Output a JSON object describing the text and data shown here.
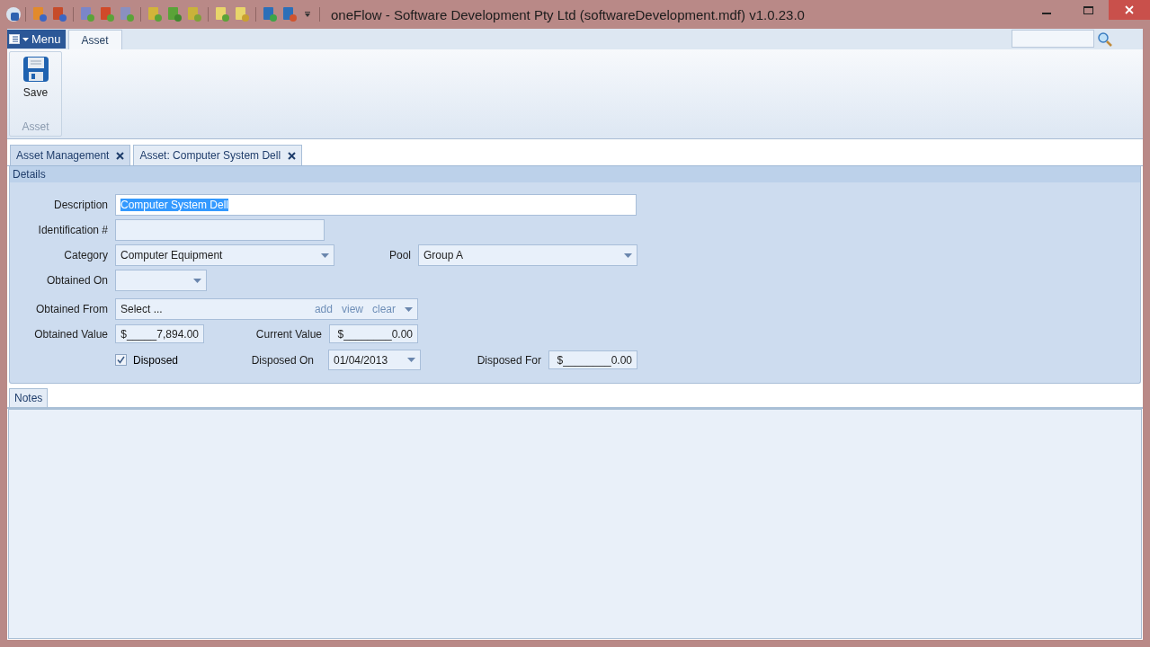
{
  "window": {
    "title": "oneFlow - Software Development Pty Ltd (softwareDevelopment.mdf) v1.0.23.0"
  },
  "ribbon": {
    "menu_button": "Menu",
    "tabs": [
      {
        "label": "Asset",
        "selected": true
      }
    ],
    "groups": [
      {
        "label": "Asset",
        "buttons": [
          {
            "label": "Save"
          }
        ]
      }
    ]
  },
  "document_tabs": [
    {
      "label": "Asset Management",
      "selected": false
    },
    {
      "label": "Asset: Computer System Dell",
      "selected": true
    }
  ],
  "details": {
    "title": "Details",
    "rows": [
      [
        {
          "label": "Description",
          "kind": "text",
          "value": "Computer System Dell",
          "highlighted": true
        }
      ],
      [
        {
          "label": "Identification #",
          "kind": "text"
        }
      ],
      [
        {
          "label": "Category",
          "kind": "combo",
          "value": "Computer Equipment"
        },
        {
          "label": "Pool",
          "kind": "combo",
          "value": "Group A"
        }
      ],
      [
        {
          "label": "Obtained On",
          "kind": "date"
        }
      ],
      [
        {
          "label": "Obtained From",
          "kind": "lookup",
          "value": "Select ...",
          "links": [
            "add",
            "view",
            "clear"
          ]
        }
      ],
      [
        {
          "label": "Obtained Value",
          "kind": "money",
          "value": "$_____7,894.00"
        },
        {
          "label": "Current Value",
          "kind": "money",
          "value": "$________0.00"
        }
      ],
      [
        {
          "label": "Disposed",
          "kind": "checkbox",
          "checked": true
        },
        {
          "label": "Disposed On",
          "kind": "date",
          "value": "01/04/2013"
        },
        {
          "label": "Disposed For",
          "kind": "money",
          "value": "$________0.00"
        }
      ]
    ]
  },
  "notes_tabs": [
    {
      "label": "Notes",
      "selected": true
    }
  ]
}
